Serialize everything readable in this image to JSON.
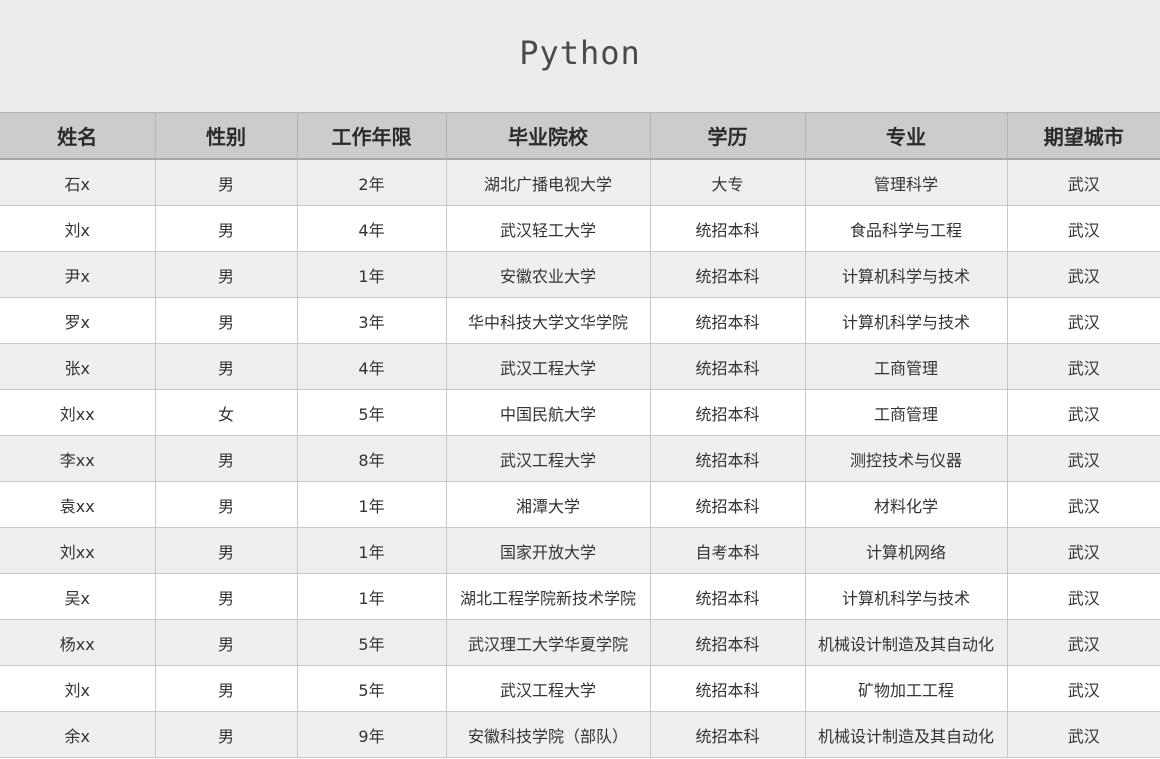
{
  "title": "Python",
  "columns": [
    "姓名",
    "性别",
    "工作年限",
    "毕业院校",
    "学历",
    "专业",
    "期望城市"
  ],
  "rows": [
    [
      "石x",
      "男",
      "2年",
      "湖北广播电视大学",
      "大专",
      "管理科学",
      "武汉"
    ],
    [
      "刘x",
      "男",
      "4年",
      "武汉轻工大学",
      "统招本科",
      "食品科学与工程",
      "武汉"
    ],
    [
      "尹x",
      "男",
      "1年",
      "安徽农业大学",
      "统招本科",
      "计算机科学与技术",
      "武汉"
    ],
    [
      "罗x",
      "男",
      "3年",
      "华中科技大学文华学院",
      "统招本科",
      "计算机科学与技术",
      "武汉"
    ],
    [
      "张x",
      "男",
      "4年",
      "武汉工程大学",
      "统招本科",
      "工商管理",
      "武汉"
    ],
    [
      "刘xx",
      "女",
      "5年",
      "中国民航大学",
      "统招本科",
      "工商管理",
      "武汉"
    ],
    [
      "李xx",
      "男",
      "8年",
      "武汉工程大学",
      "统招本科",
      "测控技术与仪器",
      "武汉"
    ],
    [
      "袁xx",
      "男",
      "1年",
      "湘潭大学",
      "统招本科",
      "材料化学",
      "武汉"
    ],
    [
      "刘xx",
      "男",
      "1年",
      "国家开放大学",
      "自考本科",
      "计算机网络",
      "武汉"
    ],
    [
      "吴x",
      "男",
      "1年",
      "湖北工程学院新技术学院",
      "统招本科",
      "计算机科学与技术",
      "武汉"
    ],
    [
      "杨xx",
      "男",
      "5年",
      "武汉理工大学华夏学院",
      "统招本科",
      "机械设计制造及其自动化",
      "武汉"
    ],
    [
      "刘x",
      "男",
      "5年",
      "武汉工程大学",
      "统招本科",
      "矿物加工工程",
      "武汉"
    ],
    [
      "余x",
      "男",
      "9年",
      "安徽科技学院（部队）",
      "统招本科",
      "机械设计制造及其自动化",
      "武汉"
    ]
  ]
}
